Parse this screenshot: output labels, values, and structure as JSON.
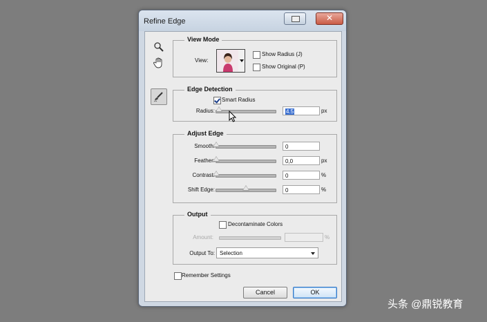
{
  "dialog": {
    "title": "Refine Edge"
  },
  "view_mode": {
    "title": "View Mode",
    "view_label": "View:",
    "show_radius": {
      "label": "Show Radius (J)",
      "checked": false
    },
    "show_original": {
      "label": "Show Original (P)",
      "checked": false
    }
  },
  "edge_detection": {
    "title": "Edge Detection",
    "smart_radius": {
      "label": "Smart Radius",
      "checked": true
    },
    "radius": {
      "label": "Radius:",
      "value": "4.5",
      "unit": "px",
      "level": 0.045
    }
  },
  "adjust_edge": {
    "title": "Adjust Edge",
    "smooth": {
      "label": "Smooth:",
      "value": "0",
      "unit": "",
      "level": 0
    },
    "feather": {
      "label": "Feather:",
      "value": "0,0",
      "unit": "px",
      "level": 0
    },
    "contrast": {
      "label": "Contrast:",
      "value": "0",
      "unit": "%",
      "level": 0
    },
    "shift_edge": {
      "label": "Shift Edge:",
      "value": "0",
      "unit": "%",
      "level": 0.5
    }
  },
  "output": {
    "title": "Output",
    "decontaminate": {
      "label": "Decontaminate Colors",
      "checked": false
    },
    "amount": {
      "label": "Amount:",
      "value": "",
      "unit": "%"
    },
    "output_to": {
      "label": "Output To:",
      "value": "Selection"
    }
  },
  "remember": {
    "label": "Remember Settings",
    "checked": false
  },
  "buttons": {
    "cancel": "Cancel",
    "ok": "OK"
  },
  "watermark": "头条 @鼎锐教育",
  "colors": {
    "selection_highlight": "#3a6fd0",
    "ok_border": "#3a7bc8"
  },
  "icons": {
    "zoom": "zoom-tool-icon",
    "hand": "hand-tool-icon",
    "brush": "refine-radius-brush-icon"
  }
}
